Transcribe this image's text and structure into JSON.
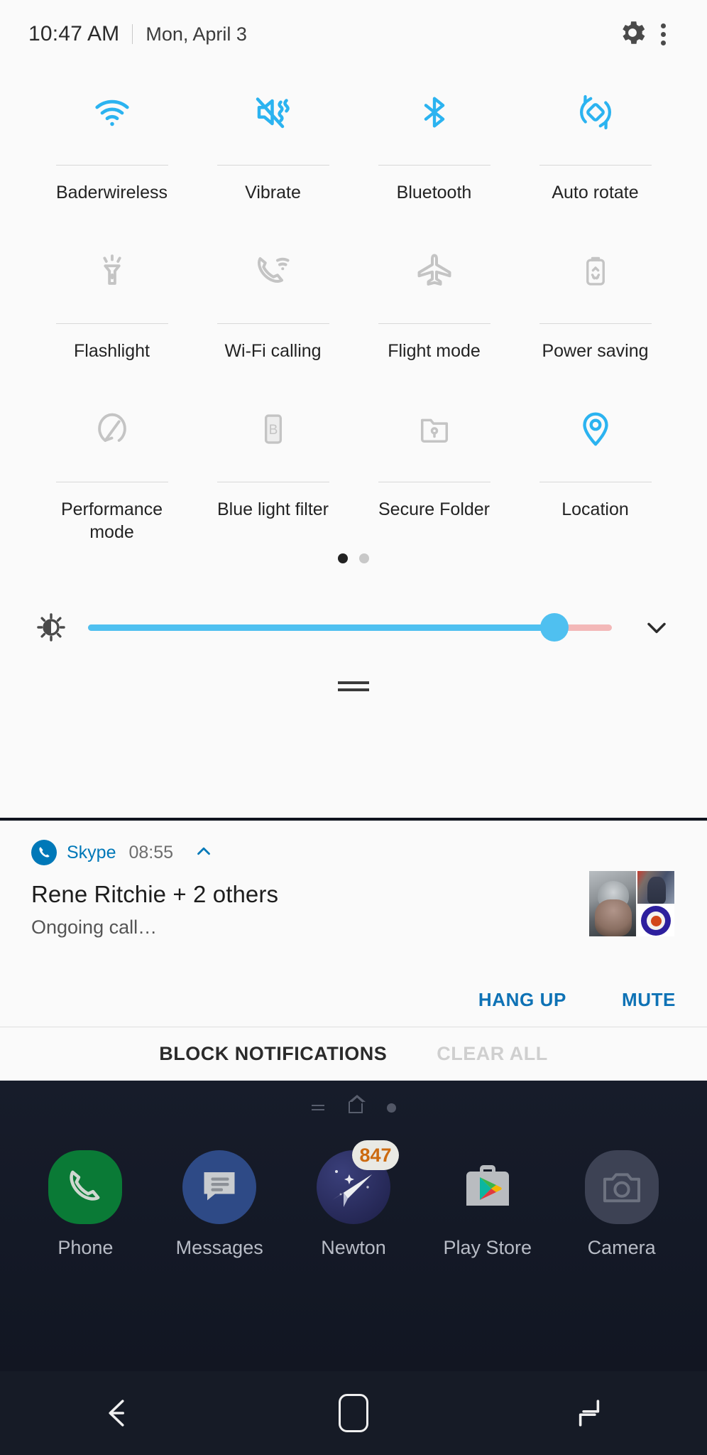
{
  "status_bar": {
    "time": "10:47 AM",
    "date": "Mon, April 3",
    "settings_icon": "gear-icon",
    "overflow_icon": "more-vertical-icon"
  },
  "quick_settings": {
    "tiles": [
      {
        "label": "Baderwireless",
        "icon": "wifi-icon",
        "active": true
      },
      {
        "label": "Vibrate",
        "icon": "vibrate-icon",
        "active": true
      },
      {
        "label": "Bluetooth",
        "icon": "bluetooth-icon",
        "active": true
      },
      {
        "label": "Auto rotate",
        "icon": "auto-rotate-icon",
        "active": true
      },
      {
        "label": "Flashlight",
        "icon": "flashlight-icon",
        "active": false
      },
      {
        "label": "Wi-Fi calling",
        "icon": "wifi-calling-icon",
        "active": false
      },
      {
        "label": "Flight mode",
        "icon": "airplane-icon",
        "active": false
      },
      {
        "label": "Power saving",
        "icon": "battery-saver-icon",
        "active": false
      },
      {
        "label": "Performance mode",
        "icon": "speedometer-icon",
        "active": false
      },
      {
        "label": "Blue light filter",
        "icon": "blue-light-filter-icon",
        "active": false
      },
      {
        "label": "Secure Folder",
        "icon": "secure-folder-icon",
        "active": false
      },
      {
        "label": "Location",
        "icon": "location-pin-icon",
        "active": true
      }
    ],
    "pages": {
      "count": 2,
      "current": 1
    },
    "brightness": {
      "icon": "brightness-icon",
      "percent": 89,
      "expand_icon": "chevron-down-icon",
      "track_color": "#4fc0f0",
      "remaining_color": "#f3b8b8"
    },
    "drag_handle": "panel-drag-handle"
  },
  "notification": {
    "app_name": "Skype",
    "app_icon": "skype-phone-icon",
    "time": "08:55",
    "collapse_icon": "chevron-up-icon",
    "title": "Rene Ritchie + 2 others",
    "body": "Ongoing call…",
    "accent_color": "#0078b8",
    "actions": [
      {
        "label": "HANG UP",
        "name": "hang-up-button"
      },
      {
        "label": "MUTE",
        "name": "mute-button"
      }
    ],
    "avatars": [
      "avatar-rene-ritchie",
      "avatar-participant-2",
      "avatar-participant-3"
    ]
  },
  "notification_footer": {
    "block_label": "BLOCK NOTIFICATIONS",
    "clear_label": "CLEAR ALL"
  },
  "home_screen": {
    "apps": [
      {
        "label": "Phone",
        "icon": "phone-icon",
        "badge": null
      },
      {
        "label": "Messages",
        "icon": "messages-icon",
        "badge": null
      },
      {
        "label": "Newton",
        "icon": "newton-mail-icon",
        "badge": "847"
      },
      {
        "label": "Play Store",
        "icon": "play-store-icon",
        "badge": null
      },
      {
        "label": "Camera",
        "icon": "camera-icon",
        "badge": null
      }
    ]
  },
  "nav_bar": {
    "back": "back-icon",
    "home": "home-icon",
    "recents": "recents-icon"
  }
}
